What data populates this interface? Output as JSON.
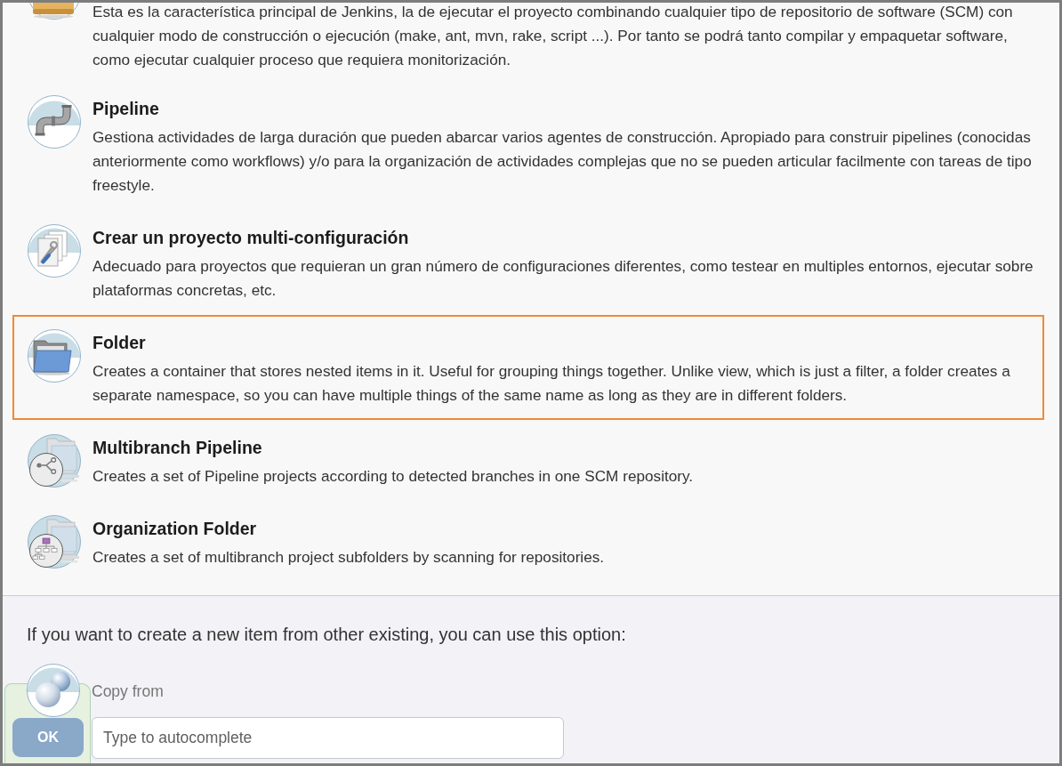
{
  "job_types": [
    {
      "description": "Esta es la característica principal de Jenkins, la de ejecutar el proyecto combinando cualquier tipo de repositorio de software (SCM) con cualquier modo de construcción o ejecución (make, ant, mvn, rake, script ...). Por tanto se podrá tanto compilar y empaquetar software, como ejecutar cualquier proceso que requiera monitorización.",
      "selected": false
    },
    {
      "title": "Pipeline",
      "description": "Gestiona actividades de larga duración que pueden abarcar varios agentes de construcción. Apropiado para construir pipelines (conocidas anteriormente como workflows) y/o para la organización de actividades complejas que no se pueden articular facilmente con tareas de tipo freestyle.",
      "selected": false
    },
    {
      "title": "Crear un proyecto multi-configuración",
      "description": "Adecuado para proyectos que requieran un gran número de configuraciones diferentes, como testear en multiples entornos, ejecutar sobre plataformas concretas, etc.",
      "selected": false
    },
    {
      "title": "Folder",
      "description": "Creates a container that stores nested items in it. Useful for grouping things together. Unlike view, which is just a filter, a folder creates a separate namespace, so you can have multiple things of the same name as long as they are in different folders.",
      "selected": true
    },
    {
      "title": "Multibranch Pipeline",
      "description": "Creates a set of Pipeline projects according to detected branches in one SCM repository.",
      "selected": false
    },
    {
      "title": "Organization Folder",
      "description": "Creates a set of multibranch project subfolders by scanning for repositories.",
      "selected": false
    }
  ],
  "copy_section": {
    "prompt": "If you want to create a new item from other existing, you can use this option:",
    "label": "Copy from",
    "field": {
      "placeholder": "Type to autocomplete"
    }
  },
  "footer": {
    "ok_button": "OK"
  }
}
